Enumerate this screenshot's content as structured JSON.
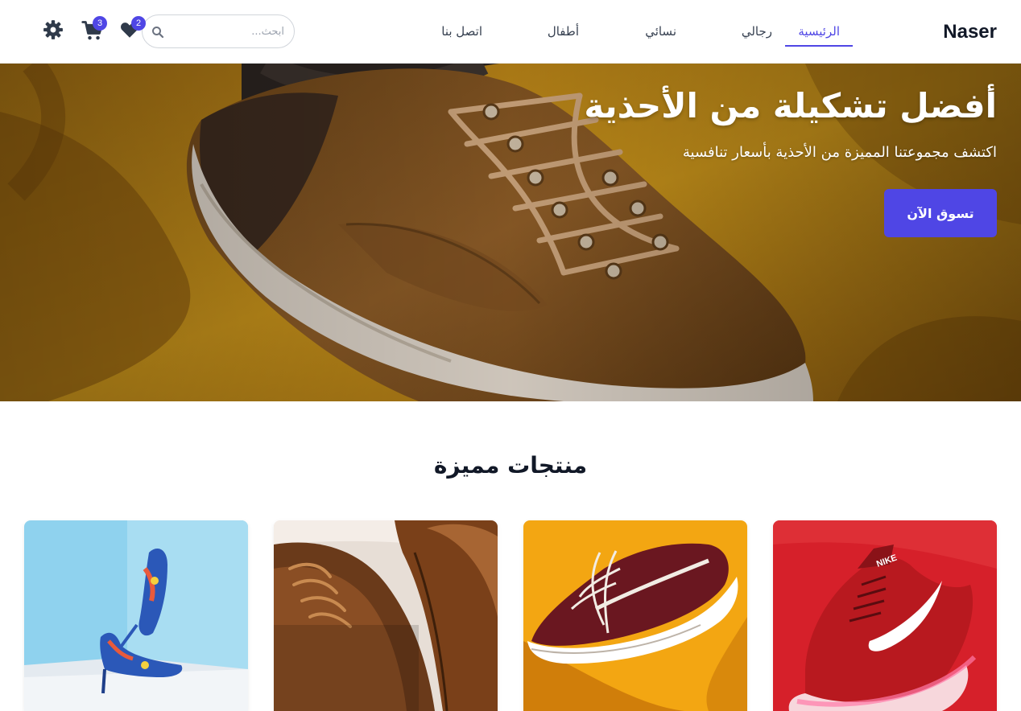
{
  "brand": {
    "logo": "Naser",
    "accent": "#4f46e5"
  },
  "nav": {
    "items": [
      {
        "label": "الرئيسية",
        "active": true
      },
      {
        "label": "رجالي",
        "active": false
      },
      {
        "label": "نسائي",
        "active": false
      },
      {
        "label": "أطفال",
        "active": false
      },
      {
        "label": "اتصل بنا",
        "active": false
      }
    ]
  },
  "search": {
    "placeholder": "ابحث..."
  },
  "header_icons": {
    "wishlist_count": "2",
    "cart_count": "3",
    "wishlist_icon": "heart-icon",
    "cart_icon": "cart-icon",
    "settings_icon": "gear-icon"
  },
  "hero": {
    "title": "أفضل تشكيلة من الأحذية",
    "subtitle": "اكتشف مجموعتنا المميزة من الأحذية بأسعار تنافسية",
    "cta": "تسوق الآن"
  },
  "featured": {
    "title": "منتجات مميزة",
    "products": [
      {
        "image": "red-nike-sneaker"
      },
      {
        "image": "maroon-vans-sneaker"
      },
      {
        "image": "brown-leather-shoes"
      },
      {
        "image": "floral-high-heels"
      }
    ]
  }
}
